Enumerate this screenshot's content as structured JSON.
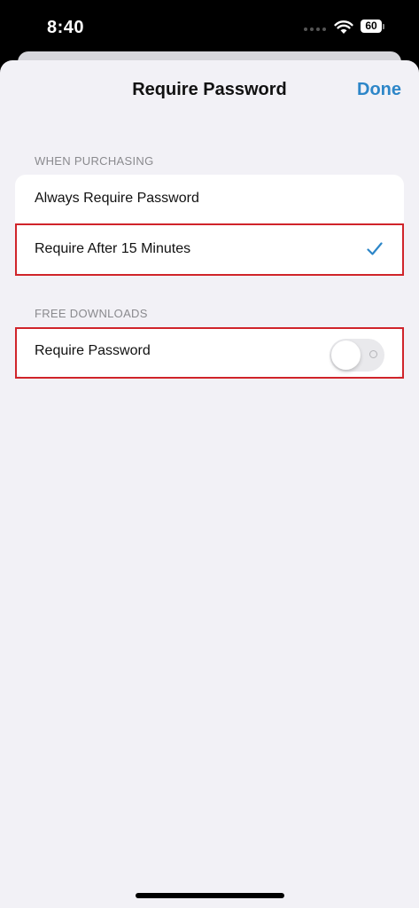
{
  "status_bar": {
    "time": "8:40",
    "battery_level": "60",
    "icons": [
      "signal-dots",
      "wifi-icon",
      "battery-icon"
    ]
  },
  "nav": {
    "title": "Require Password",
    "done_label": "Done",
    "accent_color": "#2d86c8"
  },
  "when_purchasing": {
    "header": "WHEN PURCHASING",
    "options": [
      {
        "label": "Always Require Password",
        "selected": false
      },
      {
        "label": "Require After 15 Minutes",
        "selected": true
      }
    ]
  },
  "free_downloads": {
    "header": "FREE DOWNLOADS",
    "toggle_label": "Require Password",
    "toggle_on": false
  },
  "highlight_color": "#d0242a"
}
